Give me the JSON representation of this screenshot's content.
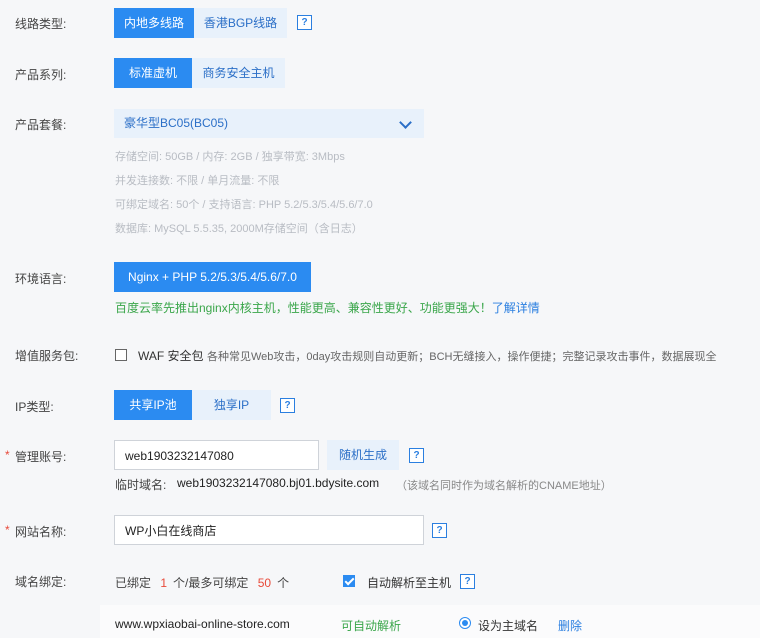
{
  "line_type": {
    "label": "线路类型:",
    "options": [
      "内地多线路",
      "香港BGP线路"
    ],
    "help": "?"
  },
  "product_series": {
    "label": "产品系列:",
    "options": [
      "标准虚机",
      "商务安全主机"
    ]
  },
  "product_plan": {
    "label": "产品套餐:",
    "selected": "豪华型BC05(BC05)",
    "specs": [
      "存储空间:  50GB / 内存:  2GB / 独享带宽:  3Mbps",
      "并发连接数:  不限 / 单月流量:  不限",
      "可绑定域名:  50个 / 支持语言:  PHP 5.2/5.3/5.4/5.6/7.0",
      "数据库:  MySQL 5.5.35,  2000M存储空间（含日志）"
    ]
  },
  "env_lang": {
    "label": "环境语言:",
    "selected": "Nginx + PHP 5.2/5.3/5.4/5.6/7.0",
    "promo": "百度云率先推出nginx内核主机，性能更高、兼容性更好、功能更强大！",
    "promo_link": "了解详情"
  },
  "value_added": {
    "label": "增值服务包:",
    "waf_name": "WAF 安全包",
    "waf_desc": "各种常见Web攻击，0day攻击规则自动更新；BCH无缝接入，操作便捷；完整记录攻击事件，数据展现全"
  },
  "ip_type": {
    "label": "IP类型:",
    "options": [
      "共享IP池",
      "独享IP"
    ],
    "help": "?"
  },
  "admin_account": {
    "label": "管理账号:",
    "value": "web1903232147080",
    "generate": "随机生成",
    "help": "?",
    "temp_domain_label": "临时域名:",
    "temp_domain": "web1903232147080.bj01.bdysite.com",
    "temp_domain_note": "（该域名同时作为域名解析的CNAME地址）"
  },
  "site_name": {
    "label": "网站名称:",
    "value": "WP小白在线商店",
    "help": "?"
  },
  "domain_binding": {
    "label": "域名绑定:",
    "bound_prefix": "已绑定",
    "bound_count": "1",
    "max_prefix": "个/最多可绑定",
    "max_count": "50",
    "unit": "个",
    "auto_resolve": "自动解析至主机",
    "help": "?",
    "domain": "www.wpxiaobai-online-store.com",
    "status": "可自动解析",
    "set_primary": "设为主域名",
    "delete": "删除"
  },
  "colors": {
    "primary": "#2b8bf1",
    "light_button": "#e8f1fb",
    "required": "#e84a3a",
    "promo_green": "#3aa64a",
    "count_red": "#e84a3a"
  }
}
